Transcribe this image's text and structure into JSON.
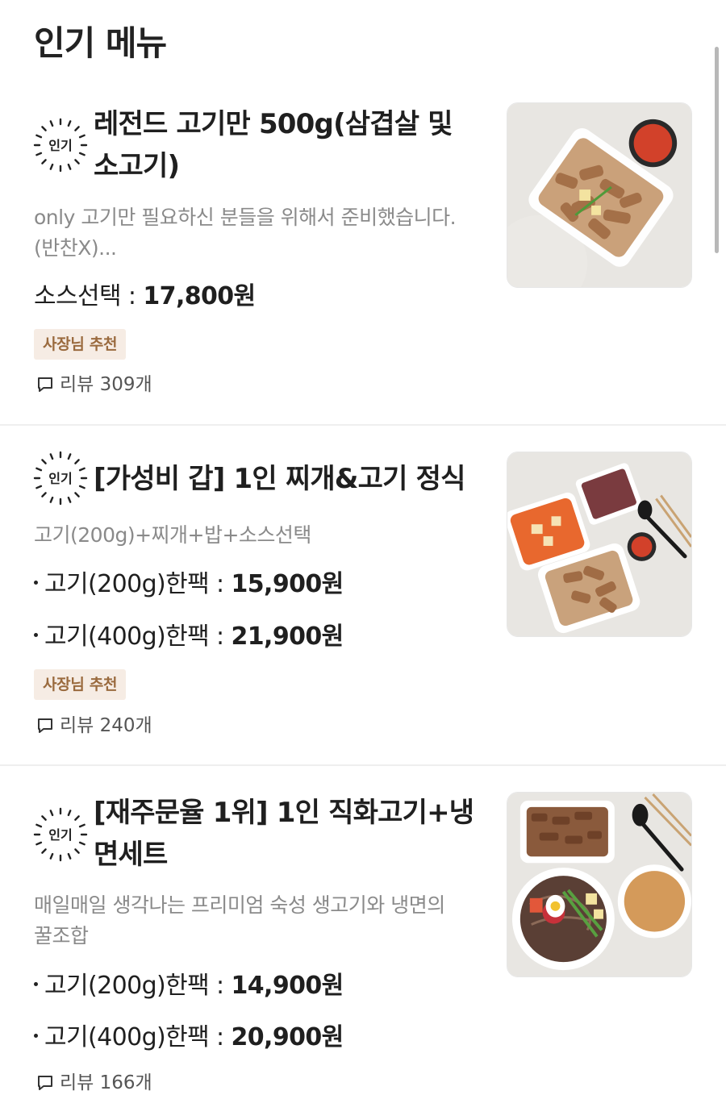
{
  "section": {
    "title": "인기 메뉴"
  },
  "items": [
    {
      "badge": "인기",
      "name_line1": "레전드 고기만 500g(삼겹살 및",
      "name_line2": "소고기)",
      "desc_line1": "only 고기만 필요하신 분들을 위해서 준비했습니다.",
      "desc_line2": "(반찬X)...",
      "price_label": "소스선택 : ",
      "price_amount": "17,800원",
      "tag": "사장님 추천",
      "reviews": "리뷰 309개",
      "image_icon": "grilled-pork-icon"
    },
    {
      "badge": "인기",
      "name_line1": "[가성비 갑] 1인 찌개&고기 정식",
      "desc_line1": "고기(200g)+찌개+밥+소스선택",
      "prices": [
        {
          "label": "고기(200g)한팩 : ",
          "amount": "15,900원"
        },
        {
          "label": "고기(400g)한팩 : ",
          "amount": "21,900원"
        }
      ],
      "tag": "사장님 추천",
      "reviews": "리뷰 240개",
      "image_icon": "stew-set-icon"
    },
    {
      "badge": "인기",
      "name_line1": "[재주문율 1위] 1인 직화고기+냉",
      "name_line2": "면세트",
      "desc_line1": "매일매일 생각나는 프리미엄 숙성 생고기와 냉면의",
      "desc_line2": "꿀조합",
      "prices": [
        {
          "label": "고기(200g)한팩 : ",
          "amount": "14,900원"
        },
        {
          "label": "고기(400g)한팩 : ",
          "amount": "20,900원"
        }
      ],
      "reviews": "리뷰 166개",
      "image_icon": "noodle-set-icon"
    }
  ],
  "colors": {
    "tag_bg": "#f6ece4",
    "tag_text": "#9a6a3e",
    "desc_text": "#8a8a8a",
    "divider": "#efefef"
  }
}
